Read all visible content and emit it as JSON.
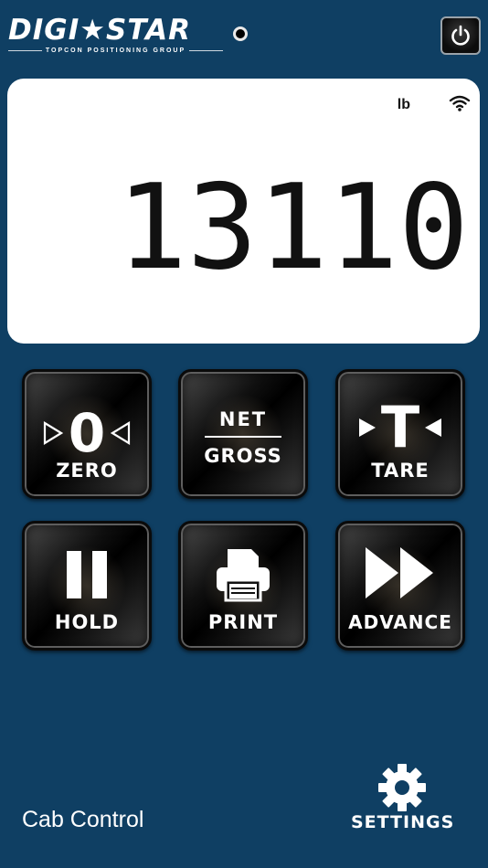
{
  "header": {
    "logo_main": "DIGI★STAR",
    "logo_sub": "TOPCON POSITIONING GROUP"
  },
  "display": {
    "unit": "lb",
    "weight": "13110"
  },
  "buttons": {
    "zero": "ZERO",
    "net": "NET",
    "gross": "GROSS",
    "tare": "TARE",
    "hold": "HOLD",
    "print": "PRINT",
    "advance": "ADVANCE"
  },
  "glyphs": {
    "zero_digit": "0",
    "tare_letter": "T"
  },
  "footer": {
    "mode_label": "Cab Control",
    "settings_label": "SETTINGS"
  },
  "icons": [
    "power-icon",
    "wifi-icon",
    "pause-icon",
    "printer-icon",
    "fast-forward-icon",
    "gear-icon"
  ]
}
